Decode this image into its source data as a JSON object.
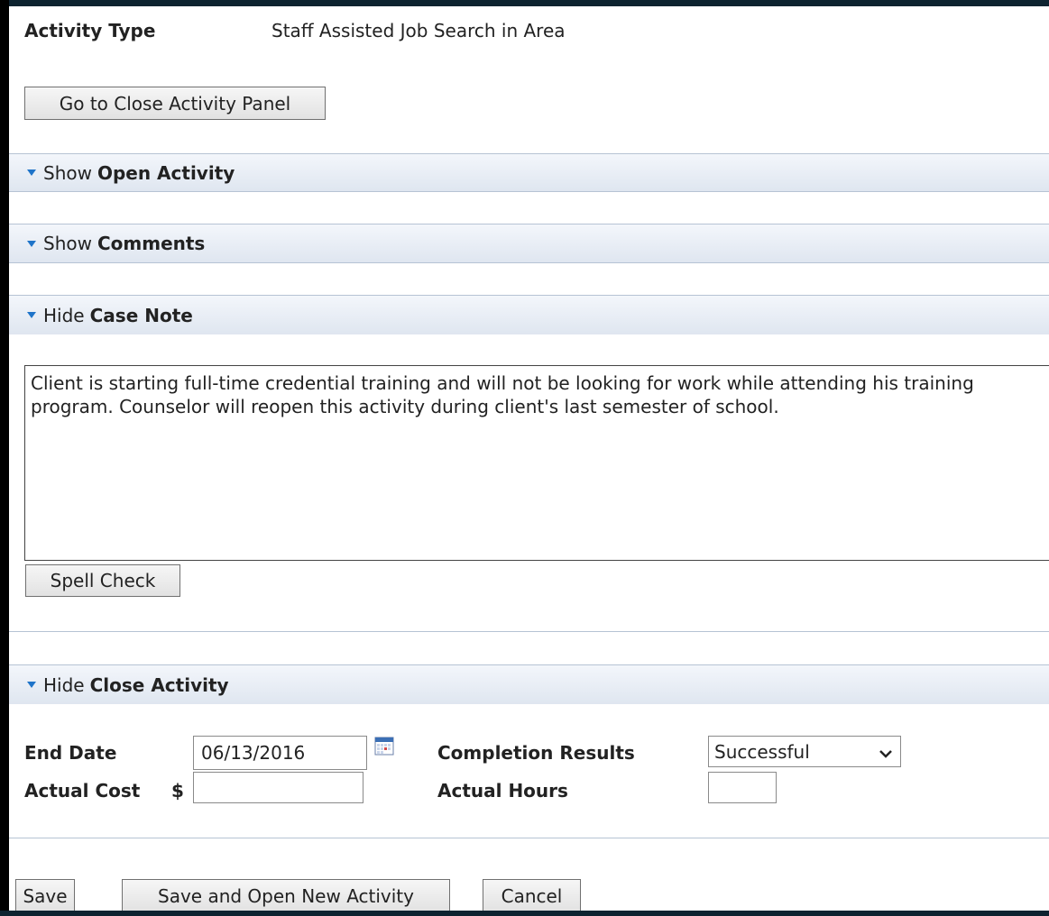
{
  "activity_type": {
    "label": "Activity Type",
    "value": "Staff Assisted Job Search in Area"
  },
  "go_close_panel_button": "Go to Close Activity Panel",
  "sections": {
    "open_activity": {
      "toggle": "Show",
      "title": "Open Activity"
    },
    "comments": {
      "toggle": "Show",
      "title": "Comments"
    },
    "case_note": {
      "toggle": "Hide",
      "title": "Case Note"
    },
    "close_activity": {
      "toggle": "Hide",
      "title": "Close Activity"
    }
  },
  "case_note_text": "Client is starting full-time credential training and will not be looking for work while attending his training program. Counselor will reopen this activity during client's last semester of school.",
  "spell_check_button": "Spell Check",
  "close_form": {
    "end_date_label": "End Date",
    "end_date_value": "06/13/2016",
    "actual_cost_label": "Actual Cost",
    "currency_symbol": "$",
    "actual_cost_value": "",
    "completion_results_label": "Completion Results",
    "completion_results_value": "Successful",
    "actual_hours_label": "Actual Hours",
    "actual_hours_value": ""
  },
  "footer_buttons": {
    "save": "Save",
    "save_open_new": "Save and Open New Activity",
    "cancel": "Cancel"
  },
  "icons": {
    "calendar": "calendar-icon",
    "dropdown": "chevron-down-icon",
    "section_toggle": "triangle-down-icon"
  },
  "colors": {
    "section_bar": "#dfe6f0",
    "accent": "#1f74c9"
  }
}
